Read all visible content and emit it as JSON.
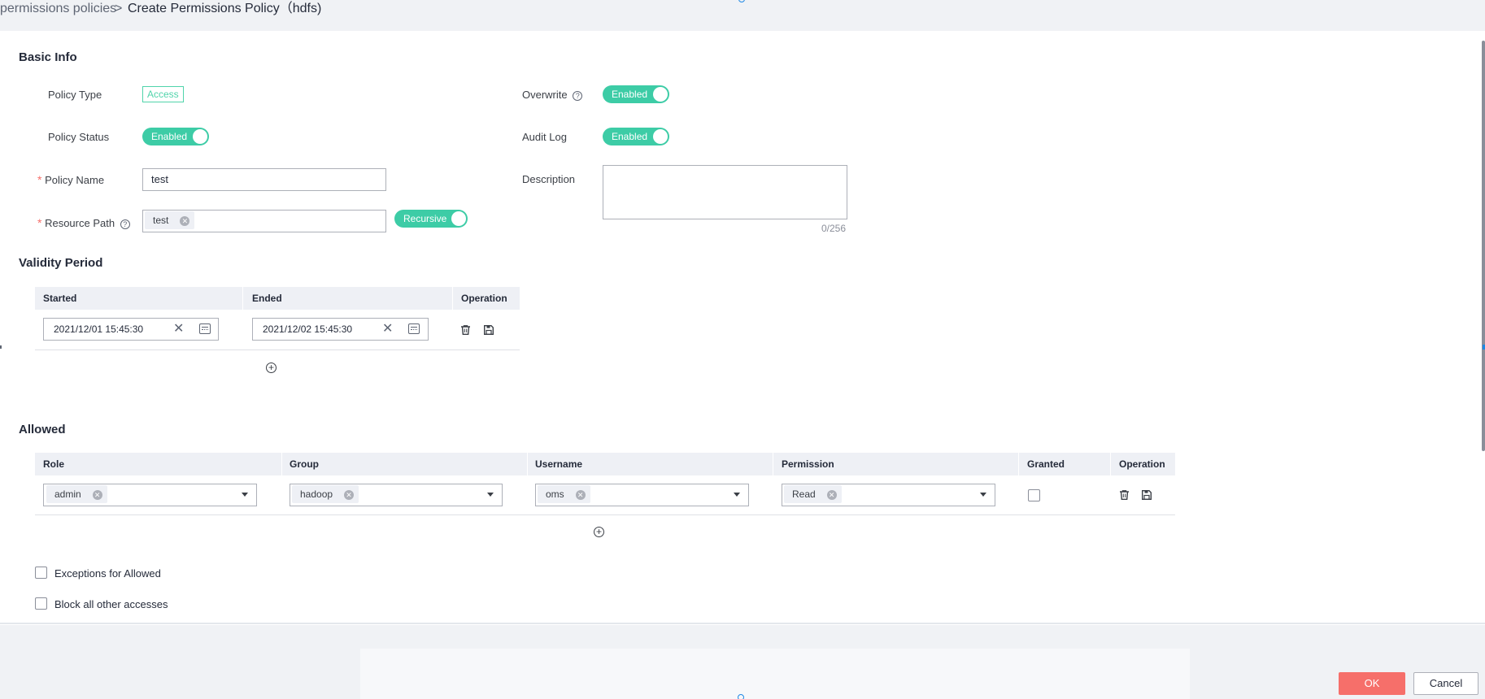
{
  "breadcrumb": {
    "parent": "permissions policies",
    "separator": ">",
    "current": "Create Permissions Policy（hdfs)"
  },
  "basic_info": {
    "title": "Basic Info",
    "policy_type_label": "Policy Type",
    "policy_type_value": "Access",
    "policy_status_label": "Policy Status",
    "policy_status_value": "Enabled",
    "policy_name_label": "Policy Name",
    "policy_name_value": "test",
    "resource_path_label": "Resource Path",
    "resource_path_chip": "test",
    "recursive_label": "Recursive",
    "overwrite_label": "Overwrite",
    "overwrite_value": "Enabled",
    "audit_log_label": "Audit Log",
    "audit_log_value": "Enabled",
    "description_label": "Description",
    "description_value": "",
    "description_counter": "0/256"
  },
  "validity": {
    "title": "Validity Period",
    "headers": [
      "Started",
      "Ended",
      "Operation"
    ],
    "rows": [
      {
        "started": "2021/12/01 15:45:30",
        "ended": "2021/12/02 15:45:30"
      }
    ]
  },
  "allowed": {
    "title": "Allowed",
    "headers": [
      "Role",
      "Group",
      "Username",
      "Permission",
      "Granted",
      "Operation"
    ],
    "rows": [
      {
        "role": "admin",
        "group": "hadoop",
        "username": "oms",
        "permission": "Read",
        "granted": false
      }
    ]
  },
  "options": {
    "exceptions_label": "Exceptions for Allowed",
    "block_label": "Block all other accesses"
  },
  "footer": {
    "ok_label": "OK",
    "cancel_label": "Cancel"
  },
  "colors": {
    "accent_green": "#3dcca6",
    "ok_button": "#f66f6a",
    "required_star": "#f66f6a"
  },
  "icons": [
    "help-icon",
    "clear-icon",
    "calendar-icon",
    "trash-icon",
    "save-icon",
    "add-circle-icon",
    "chevron-down-icon"
  ]
}
